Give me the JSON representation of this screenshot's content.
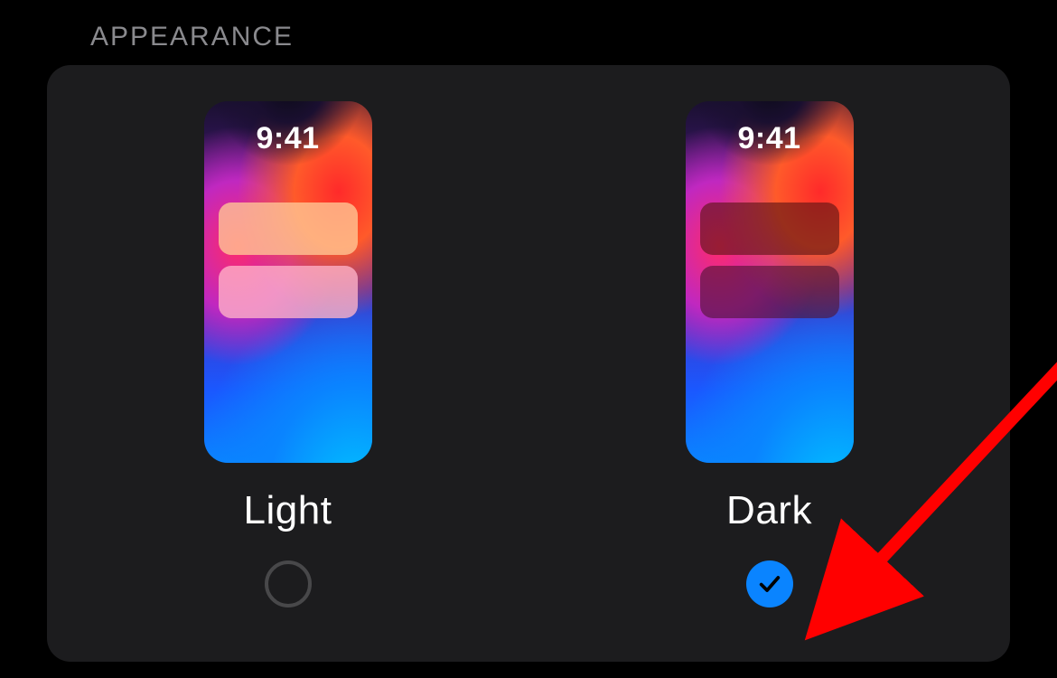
{
  "section": {
    "title": "APPEARANCE"
  },
  "colors": {
    "accent": "#0a84ff",
    "annotation": "#ff0000"
  },
  "preview": {
    "time": "9:41"
  },
  "options": {
    "light": {
      "label": "Light",
      "selected": false
    },
    "dark": {
      "label": "Dark",
      "selected": true
    }
  },
  "annotation": {
    "type": "arrow",
    "target": "radio-dark"
  }
}
